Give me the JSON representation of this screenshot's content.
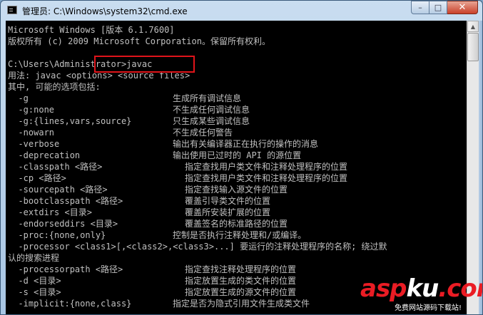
{
  "window": {
    "title": "管理员: C:\\Windows\\system32\\cmd.exe",
    "controls": {
      "minimize": "–",
      "maximize": "□",
      "close": "✕"
    }
  },
  "console": {
    "lines": [
      {
        "text": "Microsoft Windows [版本 6.1.7600]"
      },
      {
        "text": "版权所有 (c) 2009 Microsoft Corporation。保留所有权利。"
      },
      {
        "text": ""
      },
      {
        "text": "C:\\Users\\Administrator>javac"
      },
      {
        "text": "用法: javac <options> <source files>"
      },
      {
        "text": "其中, 可能的选项包括:"
      },
      {
        "text": "  -g",
        "desc": "生成所有调试信息"
      },
      {
        "text": "  -g:none",
        "desc": "不生成任何调试信息"
      },
      {
        "text": "  -g:{lines,vars,source}",
        "desc": "只生成某些调试信息"
      },
      {
        "text": "  -nowarn",
        "desc": "不生成任何警告"
      },
      {
        "text": "  -verbose",
        "desc": "输出有关编译器正在执行的操作的消息"
      },
      {
        "text": "  -deprecation",
        "desc": "输出使用已过时的 API 的源位置"
      },
      {
        "text": "  -classpath <路径>",
        "desc": "指定查找用户类文件和注释处理程序的位置",
        "wide": true
      },
      {
        "text": "  -cp <路径>",
        "desc": "指定查找用户类文件和注释处理程序的位置",
        "wide": true
      },
      {
        "text": "  -sourcepath <路径>",
        "desc": "指定查找输入源文件的位置",
        "wide": true
      },
      {
        "text": "  -bootclasspath <路径>",
        "desc": "覆盖引导类文件的位置",
        "wide": true
      },
      {
        "text": "  -extdirs <目录>",
        "desc": "覆盖所安装扩展的位置",
        "wide": true
      },
      {
        "text": "  -endorseddirs <目录>",
        "desc": "覆盖签名的标准路径的位置",
        "wide": true
      },
      {
        "text": "  -proc:{none,only}",
        "desc": "控制是否执行注释处理和/或编译。"
      },
      {
        "text": "  -processor <class1>[,<class2>,<class3>...] 要运行的注释处理程序的名称; 绕过默"
      },
      {
        "text": "认的搜索进程"
      },
      {
        "text": "  -processorpath <路径>",
        "desc": "指定查找注释处理程序的位置",
        "wide": true
      },
      {
        "text": "  -d <目录>",
        "desc": "指定放置生成的类文件的位置",
        "wide": true
      },
      {
        "text": "  -s <目录>",
        "desc": "指定放置生成的源文件的位置",
        "wide": true
      },
      {
        "text": "  -implicit:{none,class}",
        "desc": "指定是否为隐式引用文件生成类文件"
      }
    ]
  },
  "watermark": {
    "brand_a": "asp",
    "brand_b": "ku",
    "domain": ".com",
    "tagline": "免费网站源码下载站!"
  },
  "colors": {
    "console_bg": "#000000",
    "console_fg": "#c0c0c0",
    "highlight": "#e0141a",
    "brand_red": "#ea1c24"
  }
}
